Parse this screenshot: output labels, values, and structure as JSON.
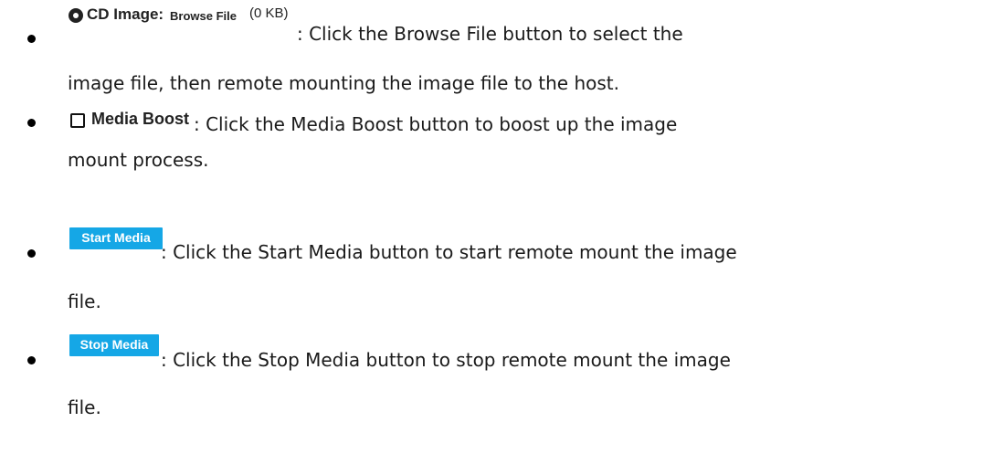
{
  "items": [
    {
      "ui": {
        "label": "CD Image:",
        "button": "Browse File",
        "size": "(0 KB)"
      },
      "desc_line1": ": Click the Browse File button to select the",
      "desc_line2": "image file, then remote mounting the image file to the host."
    },
    {
      "ui": {
        "label": "Media Boost"
      },
      "desc_line1": ": Click the Media Boost button to boost up the image",
      "desc_line2": "mount process."
    },
    {
      "ui": {
        "button": "Start Media"
      },
      "desc_line1": ": Click the Start Media button to start remote mount the image",
      "desc_line2": "file."
    },
    {
      "ui": {
        "button": "Stop Media"
      },
      "desc_line1": ": Click the Stop Media button to stop remote mount the image",
      "desc_line2": "file."
    }
  ],
  "colors": {
    "button_bg": "#15a7e6",
    "button_text": "#ffffff",
    "text": "#1a1a1a"
  },
  "icons": {
    "bullet": "bullet-dot",
    "cd": "cd-disc-icon",
    "checkbox": "checkbox-unchecked"
  }
}
